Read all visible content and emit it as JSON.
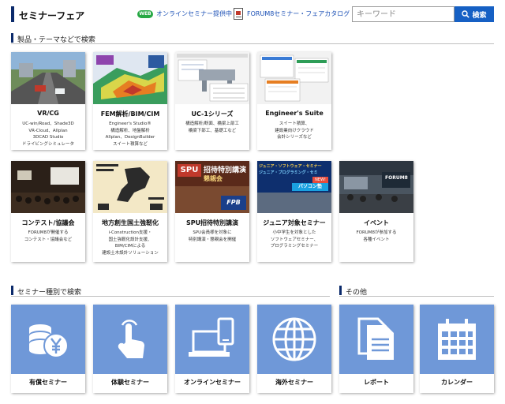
{
  "header": {
    "title": "セミナーフェア",
    "web_badge": "WEB",
    "online_link": "オンラインセミナー提供中",
    "catalog_link": "FORUM8セミナー・フェアカタログ",
    "search_placeholder": "キーワード",
    "search_button": "検索"
  },
  "sections": {
    "products": "製品・テーマなどで検索",
    "seminar_types": "セミナー種別で検索",
    "other": "その他"
  },
  "product_cards": [
    {
      "title": "VR/CG",
      "desc": "UC-win/Road、Shade3D\nVR-Cloud、Allplan\n3DCAD Studio\nドライビングシミュレータ"
    },
    {
      "title": "FEM解析/BIM/CIM",
      "desc": "Engineer's Studio®\n構造解析、地盤解析\nAllplan、DesignBuilder\nスイート積算など"
    },
    {
      "title": "UC-1シリーズ",
      "desc": "構造解析/断面、橋梁上部工\n橋梁下部工、基礎工など"
    },
    {
      "title": "Engineer's Suite",
      "desc": "スイート積算、\n建設業向けクラウド\n会計シリーズなど"
    },
    {
      "title": "コンテスト/協議会",
      "desc": "FORUM8が開催する\nコンテスト・協議会など"
    },
    {
      "title": "地方創生国土強靭化",
      "desc": "i-Construction支援・\n国土強靭化設計支援、\nBIM/CIMによる\n建設土木設計ソリューション"
    },
    {
      "title": "SPU招待特別講演",
      "desc": "SPU会員様を対象に\n特別講演・懇親会を開催"
    },
    {
      "title": "ジュニア対象セミナー",
      "desc": "小中学生を対象とした\nソフトウェアセミナー、\nプログラミングセミナー"
    },
    {
      "title": "イベント",
      "desc": "FORUM8が参加する\n各種イベント"
    }
  ],
  "image_text": {
    "spu_title": "招待特別講演",
    "spu_sub": "懇親会",
    "spu_logo": "SPU",
    "junior_title": "ジュニア・ソフトウェア・セミナー",
    "junior_sub": "ジュニア・プログラミング・セミ",
    "junior_tag": "NEW!",
    "junior_banner": "パソコン塾",
    "event_sign": "FORUM8"
  },
  "seminar_tiles": [
    {
      "label": "有償セミナー",
      "icon": "coins-yen-icon"
    },
    {
      "label": "体験セミナー",
      "icon": "hand-pointer-icon"
    },
    {
      "label": "オンラインセミナー",
      "icon": "laptop-phone-icon"
    },
    {
      "label": "海外セミナー",
      "icon": "globe-icon"
    }
  ],
  "other_tiles": [
    {
      "label": "レポート",
      "icon": "documents-icon"
    },
    {
      "label": "カレンダー",
      "icon": "calendar-icon"
    }
  ],
  "colors": {
    "accent": "#0b2a6b",
    "tile_blue": "#6f98d8",
    "search_button": "#1660c4",
    "link": "#1a4fb5",
    "web_badge": "#27a844"
  }
}
